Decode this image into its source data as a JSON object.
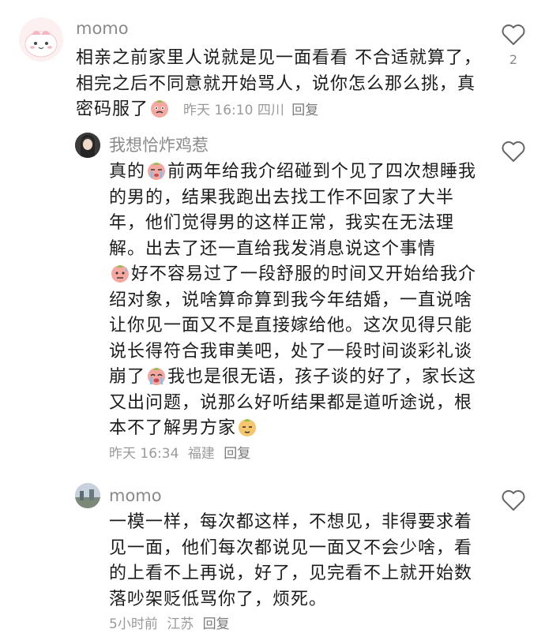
{
  "comments": [
    {
      "username": "momo",
      "text_1": "相亲之前家里人说就是见一面看看 不合适就算了，相完之后不同意就开始骂人，说你怎么那么挑，真密码服了",
      "time": "昨天 16:10",
      "location": "四川",
      "reply": "回复",
      "likes": "2"
    },
    {
      "username": "我想恰炸鸡惹",
      "text_1": "真的",
      "text_2": "前两年给我介绍碰到个见了四次想睡我的男的，结果我跑出去找工作不回家了大半年，他们觉得男的这样正常，我实在无法理解。出去了还一直给我发消息说这个事情",
      "text_3": "好不容易过了一段舒服的时间又开始给我介绍对象，说啥算命算到我今年结婚，一直说啥让你见一面又不是直接嫁给他。这次见得只能说长得符合我审美吧，处了一段时间谈彩礼谈崩了",
      "text_4": "我也是很无语，孩子谈的好了，家长这又出问题，说那么好听结果都是道听途说，根本不了解男方家",
      "time": "昨天 16:34",
      "location": "福建",
      "reply": "回复"
    },
    {
      "username": "momo",
      "text_1": "一模一样，每次都这样，不想见，非得要求着见一面，他们每次都说见一面又不会少啥，看的上看不上再说，好了，见完看不上就开始数落吵架贬低骂你了，烦死。",
      "time": "5小时前",
      "location": "江苏",
      "reply": "回复"
    }
  ],
  "colors": {
    "text": "#1c1c1c",
    "meta": "#9a9a9a",
    "username": "#8a8a8a",
    "emoji_pink": "#f6a7a0"
  },
  "icons": {
    "like": "heart-outline-icon",
    "emoji": "peach-face-emoji-icon"
  }
}
